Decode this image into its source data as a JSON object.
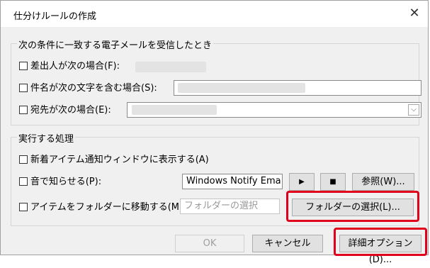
{
  "window": {
    "title": "仕分けルールの作成",
    "close_glyph": "✕"
  },
  "conditions": {
    "group_label": "次の条件に一致する電子メールを受信したとき",
    "from_label": "差出人が次の場合(F):",
    "subject_label": "件名が次の文字を含む場合(S):",
    "sent_to_label": "宛先が次の場合(E):",
    "dropdown_glyph": "⌵"
  },
  "actions": {
    "group_label": "実行する処理",
    "new_item_alert_label": "新着アイテム通知ウィンドウに表示する(A)",
    "play_sound_label": "音で知らせる(P):",
    "sound_file_value": "Windows Notify Ema",
    "play_glyph": "▶",
    "stop_glyph": "■",
    "browse_label": "参照(W)...",
    "move_folder_label": "アイテムをフォルダーに移動する(M):",
    "folder_field_value": "フォルダーの選択",
    "select_folder_label": "フォルダーの選択(L)..."
  },
  "footer": {
    "ok_label": "OK",
    "cancel_label": "キャンセル",
    "advanced_label": "詳細オプション(D)..."
  },
  "colors": {
    "highlight": "#e0001b",
    "dialog_bg": "#f0f0f0"
  }
}
